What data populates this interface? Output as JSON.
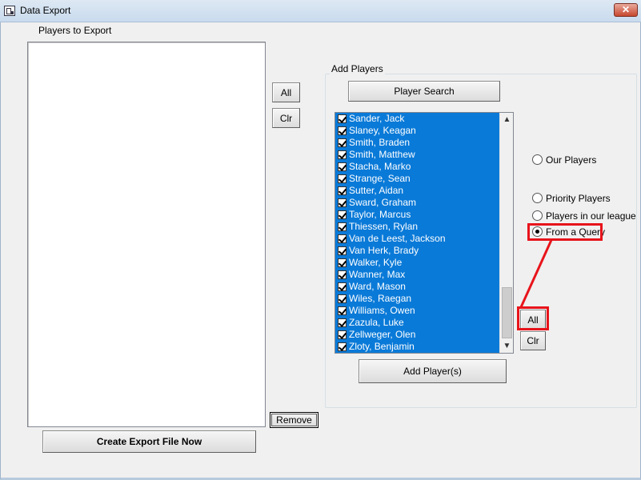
{
  "window": {
    "title": "Data Export",
    "close_glyph": "✕"
  },
  "left": {
    "title": "Players to Export"
  },
  "buttons": {
    "all_left": "All",
    "clr_left": "Clr",
    "remove": "Remove",
    "create_export": "Create Export File Now",
    "player_search": "Player Search",
    "add_players": "Add Player(s)",
    "all_right": "All",
    "clr_right": "Clr"
  },
  "add_players": {
    "title": "Add Players",
    "players": [
      "Sander, Jack",
      "Slaney, Keagan",
      "Smith, Braden",
      "Smith, Matthew",
      "Stacha, Marko",
      "Strange, Sean",
      "Sutter, Aidan",
      "Sward, Graham",
      "Taylor, Marcus",
      "Thiessen, Rylan",
      "Van de Leest, Jackson",
      "Van Herk, Brady",
      "Walker, Kyle",
      "Wanner, Max",
      "Ward, Mason",
      "Wiles, Raegan",
      "Williams, Owen",
      "Zazula, Luke",
      "Zellweger, Olen",
      "Zloty, Benjamin"
    ],
    "all_checked": true
  },
  "source_options": [
    {
      "label": "Our Players",
      "selected": false
    },
    {
      "label": "Priority Players",
      "selected": false
    },
    {
      "label": "Players in our league",
      "selected": false
    },
    {
      "label": "From a Query",
      "selected": true
    }
  ],
  "icons": {
    "app": "data-export-app-icon",
    "scroll_up": "▲",
    "scroll_down": "▼"
  },
  "colors": {
    "selection": "#0a7ad8",
    "highlight": "#e8141b"
  }
}
